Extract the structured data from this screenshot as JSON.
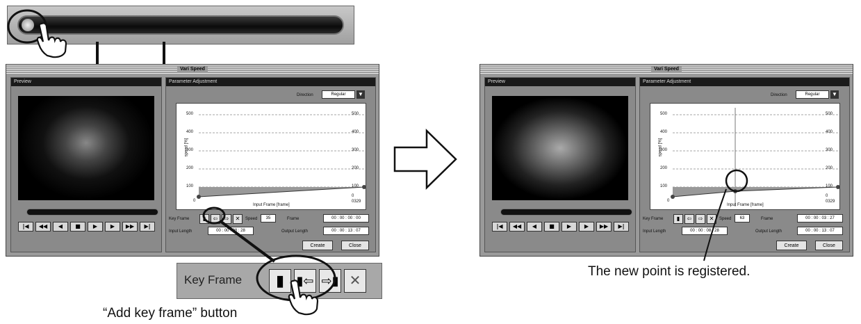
{
  "zoom_slider": {
    "knob": "slider-knob"
  },
  "left_window": {
    "title": "Vari Speed",
    "preview_title": "Preview",
    "param_title": "Parameter Adjustment",
    "direction_label": "Direction",
    "direction_value": "Regular",
    "graph": {
      "y_ticks": [
        "500",
        "400",
        "300",
        "200",
        "100",
        "0"
      ],
      "y_ticks_right": [
        "500",
        "400",
        "300",
        "200",
        "100",
        "0"
      ],
      "x_start": "0",
      "x_end": "0329",
      "ylabel": "speed [%]",
      "xlabel": "Input Frame [frame]"
    },
    "transport": [
      "|◀",
      "◀◀",
      "◀",
      "■",
      "▶",
      "▶",
      "▶▶",
      "▶|"
    ],
    "key_frame_label": "Key Frame",
    "speed_label": "Speed",
    "speed_value": "35",
    "frame_label": "Frame",
    "frame_value": "00 : 00 : 00 : 00",
    "input_length_label": "Input Length",
    "input_length_value": "00 : 00 : 08 : 28",
    "output_length_label": "Output Length",
    "output_length_value": "00 : 00 : 13 : 07",
    "create": "Create",
    "close": "Close"
  },
  "right_window": {
    "title": "Vari Speed",
    "preview_title": "Preview",
    "param_title": "Parameter Adjustment",
    "direction_label": "Direction",
    "direction_value": "Regular",
    "graph": {
      "y_ticks": [
        "500",
        "400",
        "300",
        "200",
        "100",
        "0"
      ],
      "y_ticks_right": [
        "500",
        "400",
        "300",
        "200",
        "100",
        "0"
      ],
      "x_start": "0",
      "x_end": "0329",
      "ylabel": "speed [%]",
      "xlabel": "Input Frame [frame]"
    },
    "transport": [
      "|◀",
      "◀◀",
      "◀",
      "■",
      "▶",
      "▶",
      "▶▶",
      "▶|"
    ],
    "key_frame_label": "Key Frame",
    "speed_label": "Speed",
    "speed_value": "63",
    "frame_label": "Frame",
    "frame_value": "00 : 00 : 03 : 27",
    "input_length_label": "Input Length",
    "input_length_value": "00 : 00 : 08 : 28",
    "output_length_label": "Output Length",
    "output_length_value": "00 : 00 : 13 : 07",
    "create": "Create",
    "close": "Close"
  },
  "zoom_keyframe": {
    "label": "Key Frame"
  },
  "captions": {
    "add_key_frame": "“Add key frame” button",
    "registered": "The new point is registered."
  }
}
